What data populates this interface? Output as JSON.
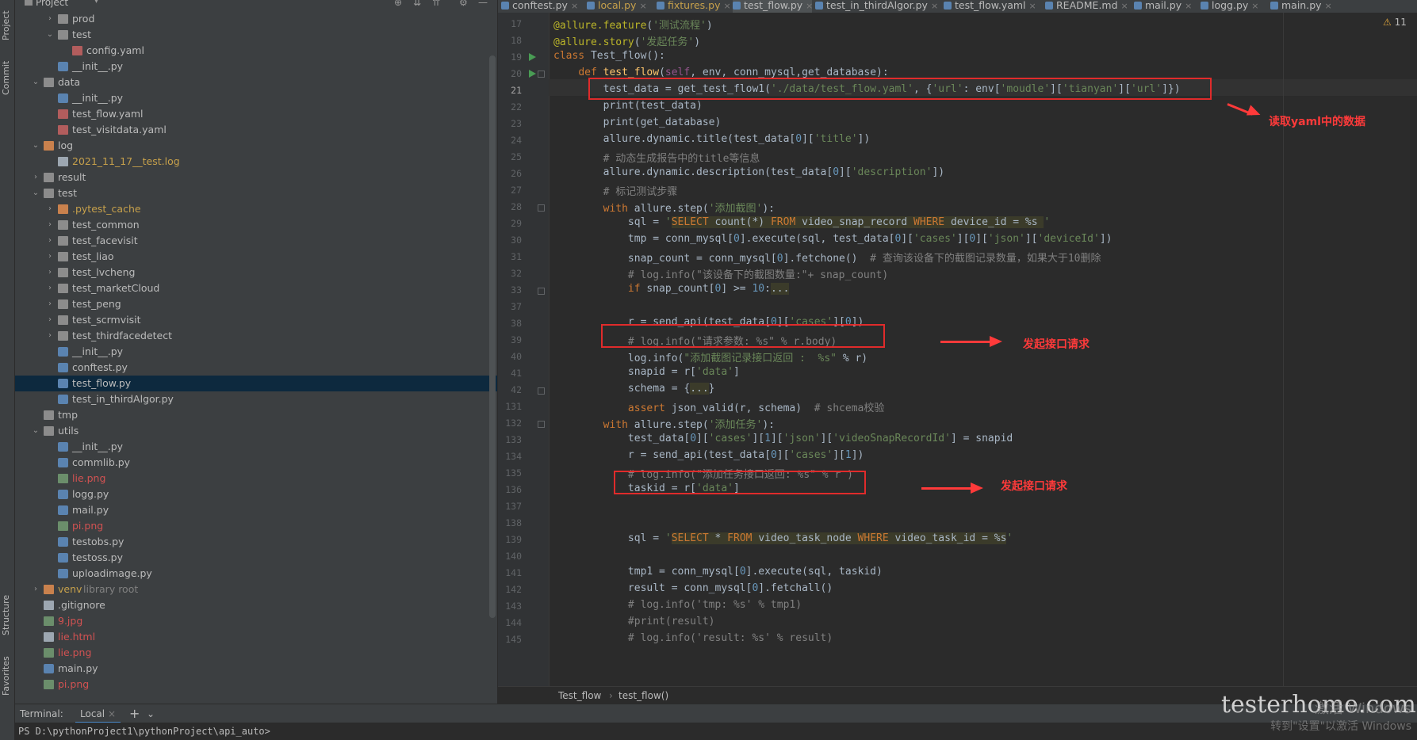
{
  "tool_strip": {
    "project_tab": "Project",
    "commit_tab": "Commit",
    "structure_tab": "Structure",
    "favorites_tab": "Favorites"
  },
  "project_panel": {
    "title": "Project",
    "tree": [
      {
        "depth": 2,
        "arrow": "›",
        "icon": "folder",
        "label": "prod",
        "style": ""
      },
      {
        "depth": 2,
        "arrow": "⌄",
        "icon": "folder",
        "label": "test",
        "style": ""
      },
      {
        "depth": 3,
        "arrow": "",
        "icon": "yaml",
        "label": "config.yaml",
        "style": ""
      },
      {
        "depth": 2,
        "arrow": "",
        "icon": "py",
        "label": "__init__.py",
        "style": ""
      },
      {
        "depth": 1,
        "arrow": "⌄",
        "icon": "folder",
        "label": "data",
        "style": ""
      },
      {
        "depth": 2,
        "arrow": "",
        "icon": "py",
        "label": "__init__.py",
        "style": ""
      },
      {
        "depth": 2,
        "arrow": "",
        "icon": "yaml",
        "label": "test_flow.yaml",
        "style": ""
      },
      {
        "depth": 2,
        "arrow": "",
        "icon": "yaml",
        "label": "test_visitdata.yaml",
        "style": ""
      },
      {
        "depth": 1,
        "arrow": "⌄",
        "icon": "folder-orange",
        "label": "log",
        "style": ""
      },
      {
        "depth": 2,
        "arrow": "",
        "icon": "txt",
        "label": "2021_11_17__test.log",
        "style": "orange"
      },
      {
        "depth": 1,
        "arrow": "›",
        "icon": "folder",
        "label": "result",
        "style": ""
      },
      {
        "depth": 1,
        "arrow": "⌄",
        "icon": "folder",
        "label": "test",
        "style": ""
      },
      {
        "depth": 2,
        "arrow": "›",
        "icon": "folder-orange",
        "label": ".pytest_cache",
        "style": "orange"
      },
      {
        "depth": 2,
        "arrow": "›",
        "icon": "folder",
        "label": "test_common",
        "style": ""
      },
      {
        "depth": 2,
        "arrow": "›",
        "icon": "folder",
        "label": "test_facevisit",
        "style": ""
      },
      {
        "depth": 2,
        "arrow": "›",
        "icon": "folder",
        "label": "test_liao",
        "style": ""
      },
      {
        "depth": 2,
        "arrow": "›",
        "icon": "folder",
        "label": "test_lvcheng",
        "style": ""
      },
      {
        "depth": 2,
        "arrow": "›",
        "icon": "folder",
        "label": "test_marketCloud",
        "style": ""
      },
      {
        "depth": 2,
        "arrow": "›",
        "icon": "folder",
        "label": "test_peng",
        "style": ""
      },
      {
        "depth": 2,
        "arrow": "›",
        "icon": "folder",
        "label": "test_scrmvisit",
        "style": ""
      },
      {
        "depth": 2,
        "arrow": "›",
        "icon": "folder",
        "label": "test_thirdfacedetect",
        "style": ""
      },
      {
        "depth": 2,
        "arrow": "",
        "icon": "py",
        "label": "__init__.py",
        "style": ""
      },
      {
        "depth": 2,
        "arrow": "",
        "icon": "py",
        "label": "conftest.py",
        "style": ""
      },
      {
        "depth": 2,
        "arrow": "",
        "icon": "py",
        "label": "test_flow.py",
        "style": "selected"
      },
      {
        "depth": 2,
        "arrow": "",
        "icon": "py",
        "label": "test_in_thirdAlgor.py",
        "style": ""
      },
      {
        "depth": 1,
        "arrow": "",
        "icon": "folder",
        "label": "tmp",
        "style": ""
      },
      {
        "depth": 1,
        "arrow": "⌄",
        "icon": "folder",
        "label": "utils",
        "style": ""
      },
      {
        "depth": 2,
        "arrow": "",
        "icon": "py",
        "label": "__init__.py",
        "style": ""
      },
      {
        "depth": 2,
        "arrow": "",
        "icon": "py",
        "label": "commlib.py",
        "style": ""
      },
      {
        "depth": 2,
        "arrow": "",
        "icon": "img",
        "label": "lie.png",
        "style": "red"
      },
      {
        "depth": 2,
        "arrow": "",
        "icon": "py",
        "label": "logg.py",
        "style": ""
      },
      {
        "depth": 2,
        "arrow": "",
        "icon": "py",
        "label": "mail.py",
        "style": ""
      },
      {
        "depth": 2,
        "arrow": "",
        "icon": "img",
        "label": "pi.png",
        "style": "red"
      },
      {
        "depth": 2,
        "arrow": "",
        "icon": "py",
        "label": "testobs.py",
        "style": ""
      },
      {
        "depth": 2,
        "arrow": "",
        "icon": "py",
        "label": "testoss.py",
        "style": ""
      },
      {
        "depth": 2,
        "arrow": "",
        "icon": "py",
        "label": "uploadimage.py",
        "style": ""
      },
      {
        "depth": 1,
        "arrow": "›",
        "icon": "folder-orange",
        "label": "venv",
        "suffix": "library root",
        "style": "orange"
      },
      {
        "depth": 1,
        "arrow": "",
        "icon": "txt",
        "label": ".gitignore",
        "style": ""
      },
      {
        "depth": 1,
        "arrow": "",
        "icon": "img",
        "label": "9.jpg",
        "style": "red"
      },
      {
        "depth": 1,
        "arrow": "",
        "icon": "txt",
        "label": "lie.html",
        "style": "red"
      },
      {
        "depth": 1,
        "arrow": "",
        "icon": "img",
        "label": "lie.png",
        "style": "red"
      },
      {
        "depth": 1,
        "arrow": "",
        "icon": "py",
        "label": "main.py",
        "style": ""
      },
      {
        "depth": 1,
        "arrow": "",
        "icon": "img",
        "label": "pi.png",
        "style": "red"
      }
    ]
  },
  "tabs": [
    {
      "label": "conftest.py",
      "active": false
    },
    {
      "label": "local.py",
      "active": false,
      "color": "orange"
    },
    {
      "label": "fixtures.py",
      "active": false,
      "color": "orange"
    },
    {
      "label": "test_flow.py",
      "active": true
    },
    {
      "label": "test_in_thirdAlgor.py",
      "active": false
    },
    {
      "label": "test_flow.yaml",
      "active": false
    },
    {
      "label": "README.md",
      "active": false
    },
    {
      "label": "mail.py",
      "active": false
    },
    {
      "label": "logg.py",
      "active": false
    },
    {
      "label": "main.py",
      "active": false
    }
  ],
  "editor": {
    "warning_count": "11",
    "line_numbers": [
      "17",
      "18",
      "19",
      "20",
      "21",
      "22",
      "23",
      "24",
      "25",
      "26",
      "27",
      "28",
      "29",
      "30",
      "31",
      "32",
      "33",
      "37",
      "38",
      "39",
      "40",
      "41",
      "42",
      "131",
      "132",
      "133",
      "134",
      "135",
      "136",
      "137",
      "138",
      "139",
      "140",
      "141",
      "142",
      "143",
      "144",
      "145"
    ],
    "current_line_index": 4
  },
  "annotations": [
    {
      "text": "读取yaml中的数据"
    },
    {
      "text": "发起接口请求"
    },
    {
      "text": "发起接口请求"
    }
  ],
  "breadcrumb": {
    "class_name": "Test_flow",
    "method_name": "test_flow()"
  },
  "terminal": {
    "title": "Terminal:",
    "tab": "Local",
    "prompt": "PS D:\\pythonProject1\\pythonProject\\api_auto>"
  },
  "watermark": {
    "text": "testerhome.com"
  },
  "windows_activation": {
    "line1": "激活 Windows",
    "line2": "转到\"设置\"以激活 Windows"
  }
}
